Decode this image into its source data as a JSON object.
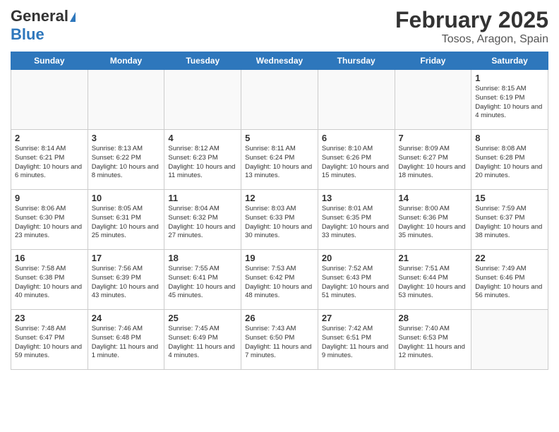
{
  "logo": {
    "general": "General",
    "blue": "Blue"
  },
  "title": "February 2025",
  "subtitle": "Tosos, Aragon, Spain",
  "days_header": [
    "Sunday",
    "Monday",
    "Tuesday",
    "Wednesday",
    "Thursday",
    "Friday",
    "Saturday"
  ],
  "weeks": [
    [
      {
        "num": "",
        "info": ""
      },
      {
        "num": "",
        "info": ""
      },
      {
        "num": "",
        "info": ""
      },
      {
        "num": "",
        "info": ""
      },
      {
        "num": "",
        "info": ""
      },
      {
        "num": "",
        "info": ""
      },
      {
        "num": "1",
        "info": "Sunrise: 8:15 AM\nSunset: 6:19 PM\nDaylight: 10 hours and 4 minutes."
      }
    ],
    [
      {
        "num": "2",
        "info": "Sunrise: 8:14 AM\nSunset: 6:21 PM\nDaylight: 10 hours and 6 minutes."
      },
      {
        "num": "3",
        "info": "Sunrise: 8:13 AM\nSunset: 6:22 PM\nDaylight: 10 hours and 8 minutes."
      },
      {
        "num": "4",
        "info": "Sunrise: 8:12 AM\nSunset: 6:23 PM\nDaylight: 10 hours and 11 minutes."
      },
      {
        "num": "5",
        "info": "Sunrise: 8:11 AM\nSunset: 6:24 PM\nDaylight: 10 hours and 13 minutes."
      },
      {
        "num": "6",
        "info": "Sunrise: 8:10 AM\nSunset: 6:26 PM\nDaylight: 10 hours and 15 minutes."
      },
      {
        "num": "7",
        "info": "Sunrise: 8:09 AM\nSunset: 6:27 PM\nDaylight: 10 hours and 18 minutes."
      },
      {
        "num": "8",
        "info": "Sunrise: 8:08 AM\nSunset: 6:28 PM\nDaylight: 10 hours and 20 minutes."
      }
    ],
    [
      {
        "num": "9",
        "info": "Sunrise: 8:06 AM\nSunset: 6:30 PM\nDaylight: 10 hours and 23 minutes."
      },
      {
        "num": "10",
        "info": "Sunrise: 8:05 AM\nSunset: 6:31 PM\nDaylight: 10 hours and 25 minutes."
      },
      {
        "num": "11",
        "info": "Sunrise: 8:04 AM\nSunset: 6:32 PM\nDaylight: 10 hours and 27 minutes."
      },
      {
        "num": "12",
        "info": "Sunrise: 8:03 AM\nSunset: 6:33 PM\nDaylight: 10 hours and 30 minutes."
      },
      {
        "num": "13",
        "info": "Sunrise: 8:01 AM\nSunset: 6:35 PM\nDaylight: 10 hours and 33 minutes."
      },
      {
        "num": "14",
        "info": "Sunrise: 8:00 AM\nSunset: 6:36 PM\nDaylight: 10 hours and 35 minutes."
      },
      {
        "num": "15",
        "info": "Sunrise: 7:59 AM\nSunset: 6:37 PM\nDaylight: 10 hours and 38 minutes."
      }
    ],
    [
      {
        "num": "16",
        "info": "Sunrise: 7:58 AM\nSunset: 6:38 PM\nDaylight: 10 hours and 40 minutes."
      },
      {
        "num": "17",
        "info": "Sunrise: 7:56 AM\nSunset: 6:39 PM\nDaylight: 10 hours and 43 minutes."
      },
      {
        "num": "18",
        "info": "Sunrise: 7:55 AM\nSunset: 6:41 PM\nDaylight: 10 hours and 45 minutes."
      },
      {
        "num": "19",
        "info": "Sunrise: 7:53 AM\nSunset: 6:42 PM\nDaylight: 10 hours and 48 minutes."
      },
      {
        "num": "20",
        "info": "Sunrise: 7:52 AM\nSunset: 6:43 PM\nDaylight: 10 hours and 51 minutes."
      },
      {
        "num": "21",
        "info": "Sunrise: 7:51 AM\nSunset: 6:44 PM\nDaylight: 10 hours and 53 minutes."
      },
      {
        "num": "22",
        "info": "Sunrise: 7:49 AM\nSunset: 6:46 PM\nDaylight: 10 hours and 56 minutes."
      }
    ],
    [
      {
        "num": "23",
        "info": "Sunrise: 7:48 AM\nSunset: 6:47 PM\nDaylight: 10 hours and 59 minutes."
      },
      {
        "num": "24",
        "info": "Sunrise: 7:46 AM\nSunset: 6:48 PM\nDaylight: 11 hours and 1 minute."
      },
      {
        "num": "25",
        "info": "Sunrise: 7:45 AM\nSunset: 6:49 PM\nDaylight: 11 hours and 4 minutes."
      },
      {
        "num": "26",
        "info": "Sunrise: 7:43 AM\nSunset: 6:50 PM\nDaylight: 11 hours and 7 minutes."
      },
      {
        "num": "27",
        "info": "Sunrise: 7:42 AM\nSunset: 6:51 PM\nDaylight: 11 hours and 9 minutes."
      },
      {
        "num": "28",
        "info": "Sunrise: 7:40 AM\nSunset: 6:53 PM\nDaylight: 11 hours and 12 minutes."
      },
      {
        "num": "",
        "info": ""
      }
    ]
  ]
}
